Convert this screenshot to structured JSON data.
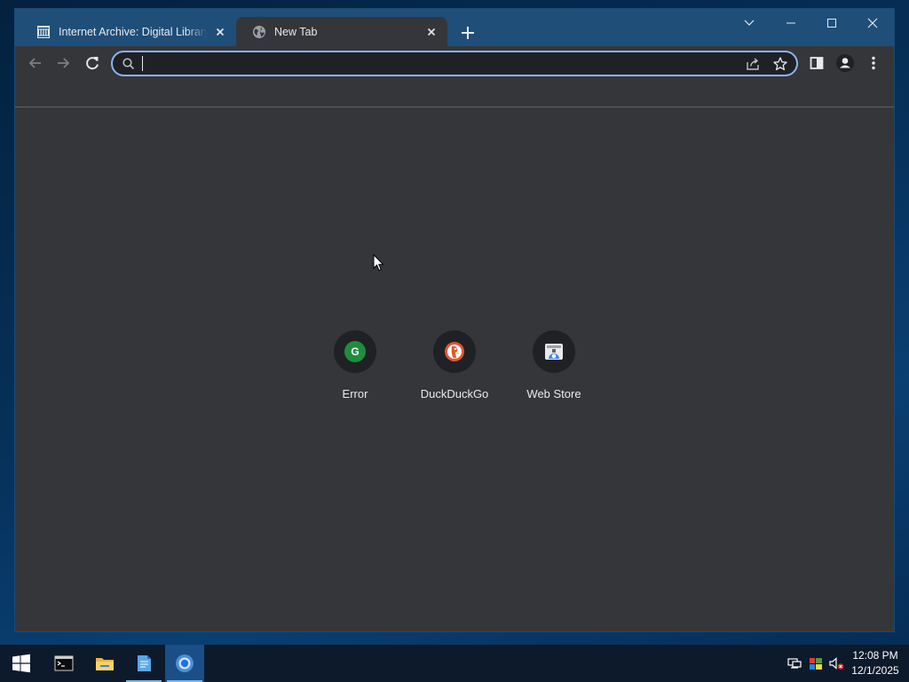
{
  "browser": {
    "tabs": [
      {
        "title": "Internet Archive: Digital Library of Free & Borrowable Books, Movies, Music & Wayback Machine",
        "favicon": "archive-icon",
        "active": false
      },
      {
        "title": "New Tab",
        "favicon": "globe-icon",
        "active": true
      }
    ],
    "omnibox": {
      "value": "",
      "placeholder": ""
    },
    "colors": {
      "frame": "#1f4e79",
      "surface": "#35363a",
      "omnibox_border": "#8ab4f8"
    }
  },
  "ntp": {
    "shortcuts": [
      {
        "label": "Error",
        "icon": "g-icon",
        "icon_text": "G"
      },
      {
        "label": "DuckDuckGo",
        "icon": "duckduckgo-icon"
      },
      {
        "label": "Web Store",
        "icon": "web-store-icon"
      }
    ]
  },
  "taskbar": {
    "apps": [
      "start-icon",
      "terminal-icon",
      "file-explorer-icon",
      "notepad-icon",
      "chrome-icon"
    ],
    "active_app": "chrome-icon",
    "tray": [
      "network-icon",
      "color-settings-icon",
      "volume-muted-icon"
    ],
    "clock": {
      "time": "12:08 PM",
      "date": "12/1/2025"
    }
  }
}
